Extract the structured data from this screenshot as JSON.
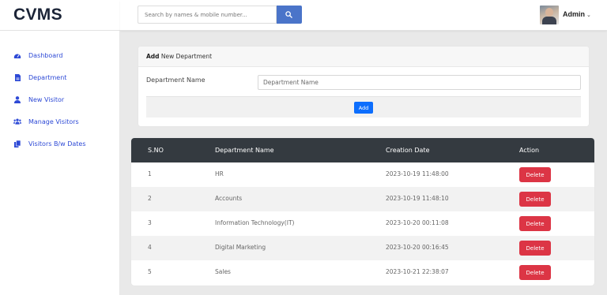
{
  "app": {
    "brand": "CVMS"
  },
  "header": {
    "search_placeholder": "Search by names & mobile number...",
    "user_name": "Admin",
    "caret": "⌄"
  },
  "sidebar": {
    "items": [
      {
        "label": "Dashboard",
        "icon": "dashboard-icon"
      },
      {
        "label": "Department",
        "icon": "file-icon"
      },
      {
        "label": "New Visitor",
        "icon": "user-icon"
      },
      {
        "label": "Manage Visitors",
        "icon": "users-icon"
      },
      {
        "label": "Visitors B/w Dates",
        "icon": "copy-icon"
      }
    ]
  },
  "form": {
    "title_bold": "Add",
    "title_rest": " New Department",
    "label": "Department Name",
    "placeholder": "Department Name",
    "value": "",
    "submit_label": "Add"
  },
  "table": {
    "headers": [
      "S.NO",
      "Department Name",
      "Creation Date",
      "Action"
    ],
    "rows": [
      {
        "sno": "1",
        "name": "HR",
        "date": "2023-10-19 11:48:00",
        "action": "Delete"
      },
      {
        "sno": "2",
        "name": "Accounts",
        "date": "2023-10-19 11:48:10",
        "action": "Delete"
      },
      {
        "sno": "3",
        "name": "Information Technology(IT)",
        "date": "2023-10-20 00:11:08",
        "action": "Delete"
      },
      {
        "sno": "4",
        "name": "Digital Marketing",
        "date": "2023-10-20 00:16:45",
        "action": "Delete"
      },
      {
        "sno": "5",
        "name": "Sales",
        "date": "2023-10-21 22:38:07",
        "action": "Delete"
      }
    ]
  },
  "colors": {
    "nav_link": "#2e4ad6",
    "search_button": "#4a74c9",
    "primary_button": "#0d6efd",
    "danger_button": "#dc3545",
    "table_header": "#343a40"
  }
}
